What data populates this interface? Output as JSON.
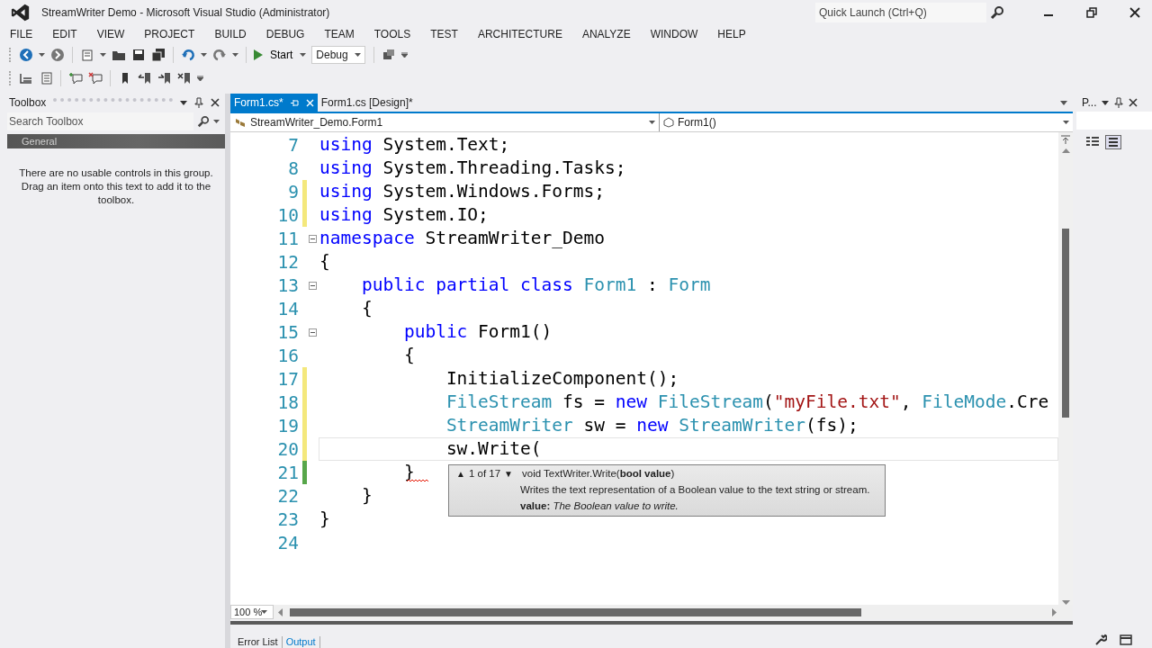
{
  "window": {
    "title": "StreamWriter Demo - Microsoft Visual Studio (Administrator)",
    "quick_launch": {
      "placeholder": "Quick Launch (Ctrl+Q)"
    }
  },
  "menu": [
    "FILE",
    "EDIT",
    "VIEW",
    "PROJECT",
    "BUILD",
    "DEBUG",
    "TEAM",
    "TOOLS",
    "TEST",
    "ARCHITECTURE",
    "ANALYZE",
    "WINDOW",
    "HELP"
  ],
  "toolbar": {
    "start_label": "Start",
    "configuration": "Debug"
  },
  "toolbox": {
    "title": "Toolbox",
    "search": {
      "placeholder": "Search Toolbox"
    },
    "group": "General",
    "message": "There are no usable controls in this group. Drag an item onto this text to add it to the toolbox."
  },
  "tabs": [
    {
      "label": "Form1.cs*",
      "selected": true
    },
    {
      "label": "Form1.cs [Design]*",
      "selected": false
    }
  ],
  "nav": {
    "type": "StreamWriter_Demo.Form1",
    "member": "Form1()"
  },
  "right_panel": {
    "title": "P..."
  },
  "code": [
    {
      "num": "7",
      "changed": false,
      "fold": false,
      "current": false,
      "tokens": [
        {
          "kind": "keyword",
          "text": "using "
        },
        {
          "kind": "plain",
          "text": "System.Text;"
        }
      ]
    },
    {
      "num": "8",
      "changed": false,
      "fold": false,
      "current": false,
      "tokens": [
        {
          "kind": "keyword",
          "text": "using "
        },
        {
          "kind": "plain",
          "text": "System.Threading.Tasks;"
        }
      ]
    },
    {
      "num": "9",
      "changed": true,
      "saved": false,
      "fold": false,
      "current": false,
      "tokens": [
        {
          "kind": "keyword",
          "text": "using "
        },
        {
          "kind": "plain",
          "text": "System.Windows.Forms;"
        }
      ]
    },
    {
      "num": "10",
      "changed": true,
      "saved": false,
      "fold": false,
      "current": false,
      "tokens": [
        {
          "kind": "keyword",
          "text": "using "
        },
        {
          "kind": "plain",
          "text": "System.IO;"
        }
      ]
    },
    {
      "num": "11",
      "changed": false,
      "fold": true,
      "current": false,
      "tokens": [
        {
          "kind": "keyword",
          "text": "namespace "
        },
        {
          "kind": "plain",
          "text": "StreamWriter_Demo"
        }
      ]
    },
    {
      "num": "12",
      "changed": false,
      "fold": false,
      "current": false,
      "tokens": [
        {
          "kind": "plain",
          "text": "{"
        }
      ]
    },
    {
      "num": "13",
      "changed": false,
      "fold": true,
      "current": false,
      "tokens": [
        {
          "kind": "keyword",
          "text": "    public partial class "
        },
        {
          "kind": "type",
          "text": "Form1"
        },
        {
          "kind": "plain",
          "text": " : "
        },
        {
          "kind": "type",
          "text": "Form"
        }
      ]
    },
    {
      "num": "14",
      "changed": false,
      "fold": false,
      "current": false,
      "tokens": [
        {
          "kind": "plain",
          "text": "    {"
        }
      ]
    },
    {
      "num": "15",
      "changed": false,
      "fold": true,
      "current": false,
      "tokens": [
        {
          "kind": "keyword",
          "text": "        public "
        },
        {
          "kind": "plain",
          "text": "Form1()"
        }
      ]
    },
    {
      "num": "16",
      "changed": false,
      "fold": false,
      "current": false,
      "tokens": [
        {
          "kind": "plain",
          "text": "        {"
        }
      ]
    },
    {
      "num": "17",
      "changed": true,
      "saved": false,
      "fold": false,
      "current": false,
      "tokens": [
        {
          "kind": "plain",
          "text": "            InitializeComponent();"
        }
      ]
    },
    {
      "num": "18",
      "changed": true,
      "saved": false,
      "fold": false,
      "current": false,
      "tokens": [
        {
          "kind": "type",
          "text": "            FileStream"
        },
        {
          "kind": "plain",
          "text": " fs = "
        },
        {
          "kind": "keyword",
          "text": "new "
        },
        {
          "kind": "type",
          "text": "FileStream"
        },
        {
          "kind": "plain",
          "text": "("
        },
        {
          "kind": "string",
          "text": "\"myFile.txt\""
        },
        {
          "kind": "plain",
          "text": ", "
        },
        {
          "kind": "type",
          "text": "FileMode"
        },
        {
          "kind": "plain",
          "text": ".Cre"
        }
      ]
    },
    {
      "num": "19",
      "changed": true,
      "saved": false,
      "fold": false,
      "current": false,
      "tokens": [
        {
          "kind": "type",
          "text": "            StreamWriter"
        },
        {
          "kind": "plain",
          "text": " sw = "
        },
        {
          "kind": "keyword",
          "text": "new "
        },
        {
          "kind": "type",
          "text": "StreamWriter"
        },
        {
          "kind": "plain",
          "text": "(fs);"
        }
      ]
    },
    {
      "num": "20",
      "changed": true,
      "saved": false,
      "fold": false,
      "current": true,
      "tokens": [
        {
          "kind": "plain",
          "text": "            sw.Write("
        }
      ]
    },
    {
      "num": "21",
      "changed": true,
      "saved": true,
      "fold": false,
      "current": false,
      "tokens": [
        {
          "kind": "plain",
          "text": "        }"
        }
      ]
    },
    {
      "num": "22",
      "changed": false,
      "fold": false,
      "current": false,
      "tokens": [
        {
          "kind": "plain",
          "text": "    }"
        }
      ]
    },
    {
      "num": "23",
      "changed": false,
      "fold": false,
      "current": false,
      "tokens": [
        {
          "kind": "plain",
          "text": "}"
        }
      ]
    },
    {
      "num": "24",
      "changed": false,
      "fold": false
    }
  ],
  "tooltip": {
    "prev": "▲",
    "counter": "1 of 17",
    "next": "▼",
    "signature": "void TextWriter.Write(**bool value**)",
    "description": "Writes the text representation of a Boolean value to the text string or stream.",
    "param": "**value:** *The Boolean value to write.*"
  },
  "zoom": "100 %",
  "output_tabs": [
    {
      "label": "Error List",
      "selected": false
    },
    {
      "label": "Output",
      "selected": true
    }
  ]
}
